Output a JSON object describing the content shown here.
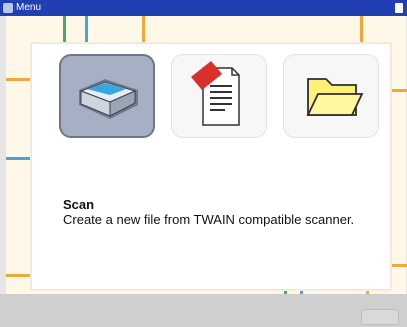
{
  "window": {
    "title": "Menu"
  },
  "options": [
    {
      "key": "scan",
      "icon": "scanner-icon",
      "selected": true
    },
    {
      "key": "pdf",
      "icon": "pdf-document-icon",
      "selected": false
    },
    {
      "key": "folder",
      "icon": "folder-icon",
      "selected": false
    }
  ],
  "selected_option": {
    "title": "Scan",
    "description": "Create a new file from TWAIN compatible scanner."
  },
  "colors": {
    "titlebar": "#1f3fb3",
    "frame_bg": "#fff8e8",
    "grid_line": "#f0a83b",
    "accent_blue": "#42a6d8",
    "accent_green": "#4aa66a",
    "selected_tile": "#a6afc3"
  }
}
